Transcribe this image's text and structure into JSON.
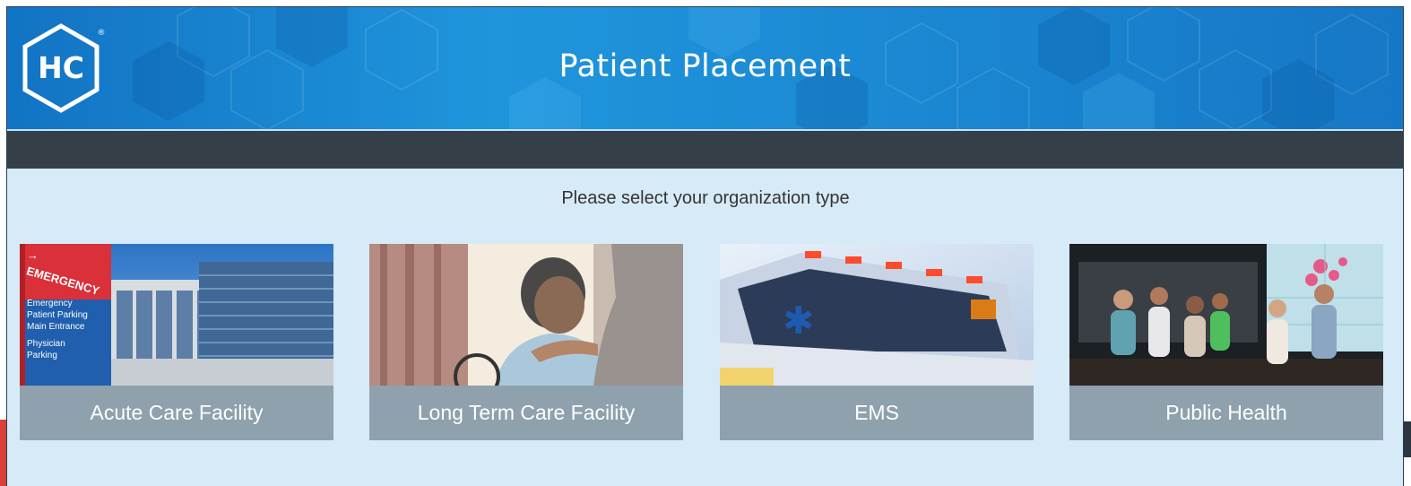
{
  "header": {
    "title": "Patient Placement",
    "logo_text": "HC",
    "logo_mark": "®"
  },
  "main": {
    "prompt": "Please select your organization type",
    "cards": [
      {
        "label": "Acute Care Facility",
        "image": "hospital-building-photo",
        "sign_lines": [
          "EMERGENCY",
          "Emergency",
          "Patient Parking",
          "Main Entrance",
          "Physician",
          "Parking"
        ]
      },
      {
        "label": "Long Term Care Facility",
        "image": "caregiver-wheelchair-photo"
      },
      {
        "label": "EMS",
        "image": "ambulance-photo"
      },
      {
        "label": "Public Health",
        "image": "team-meeting-photo"
      }
    ]
  },
  "colors": {
    "banner": "#1f95dc",
    "navbar": "#353f48",
    "background": "#d6ebf7",
    "card_label": "#8ea1ad"
  }
}
